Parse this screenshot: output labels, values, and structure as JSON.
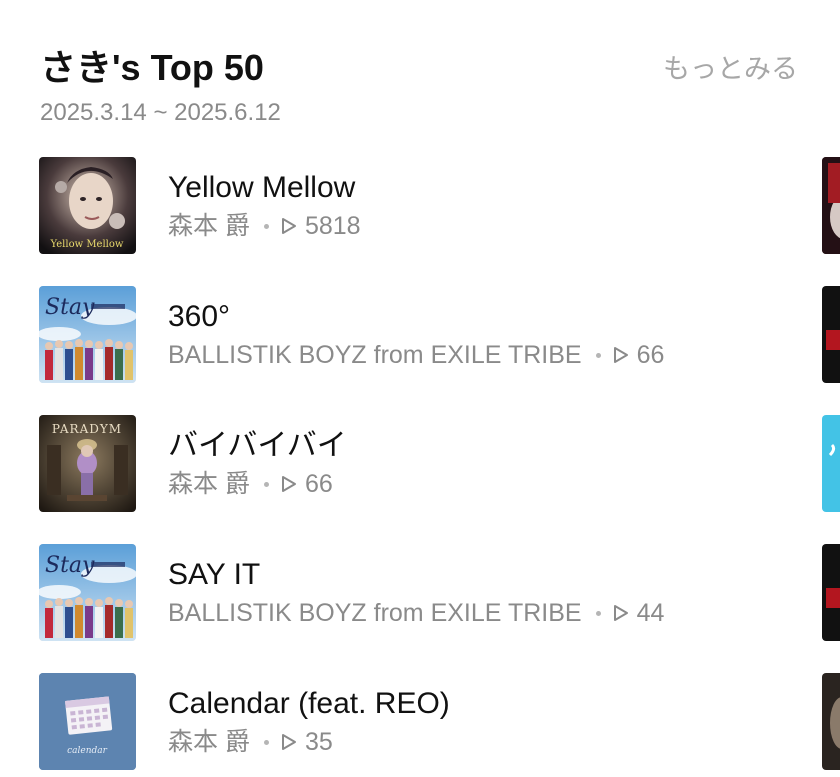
{
  "header": {
    "title": "さき's Top 50",
    "more_label": "もっとみる",
    "date_range": "2025.3.14 ~ 2025.6.12"
  },
  "tracks": [
    {
      "title": "Yellow Mellow",
      "artist": "森本 爵",
      "plays": "5818",
      "artwork_icon": "yellow-mellow-artwork",
      "artwork_text": "Yellow Mellow"
    },
    {
      "title": "360°",
      "artist": "BALLISTIK BOYZ from EXILE TRIBE",
      "plays": "66",
      "artwork_icon": "stay-album-artwork",
      "artwork_text": "Stay"
    },
    {
      "title": "バイバイバイ",
      "artist": "森本 爵",
      "plays": "66",
      "artwork_icon": "paradym-artwork",
      "artwork_text": "PARADYM"
    },
    {
      "title": "SAY IT",
      "artist": "BALLISTIK BOYZ from EXILE TRIBE",
      "plays": "44",
      "artwork_icon": "stay-album-artwork",
      "artwork_text": "Stay"
    },
    {
      "title": "Calendar (feat. REO)",
      "artist": "森本 爵",
      "plays": "35",
      "artwork_icon": "calendar-artwork",
      "artwork_text": "calendar"
    }
  ],
  "colors": {
    "title": "#111111",
    "secondary": "#8a8a8a",
    "more": "#a7a7a7",
    "calendar_bg": "#5d84b0"
  }
}
